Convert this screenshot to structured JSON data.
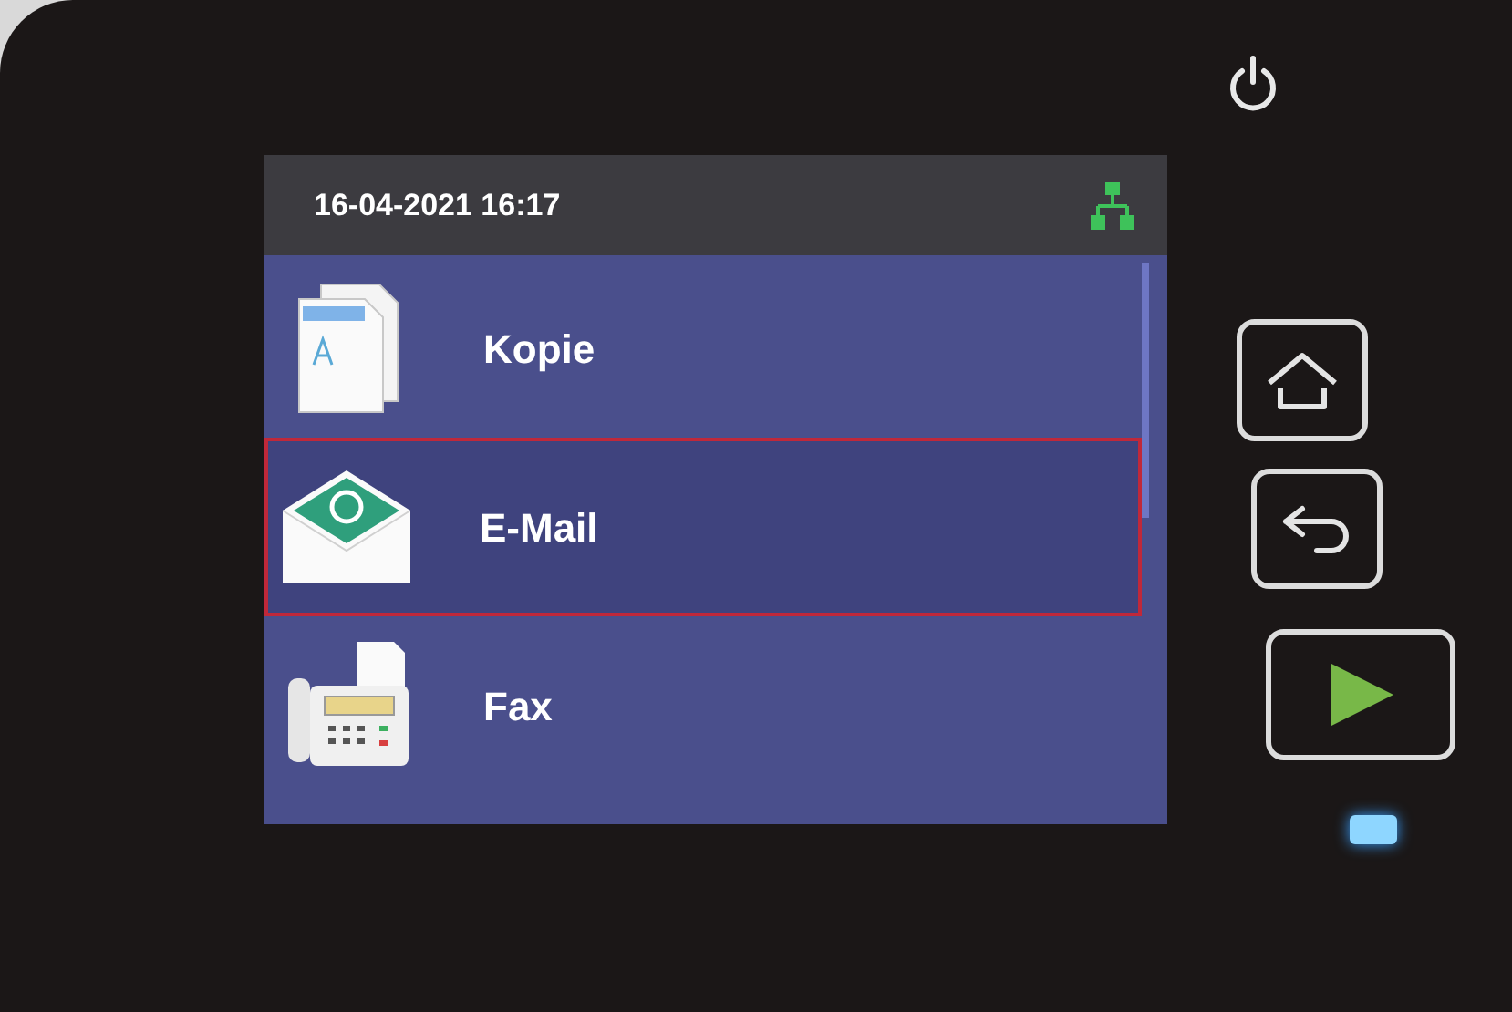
{
  "status_bar": {
    "datetime": "16-04-2021 16:17"
  },
  "menu_items": [
    {
      "kind": "copy",
      "label": "Kopie",
      "selected": false
    },
    {
      "kind": "email",
      "label": "E-Mail",
      "selected": true
    },
    {
      "kind": "fax",
      "label": "Fax",
      "selected": false
    }
  ]
}
